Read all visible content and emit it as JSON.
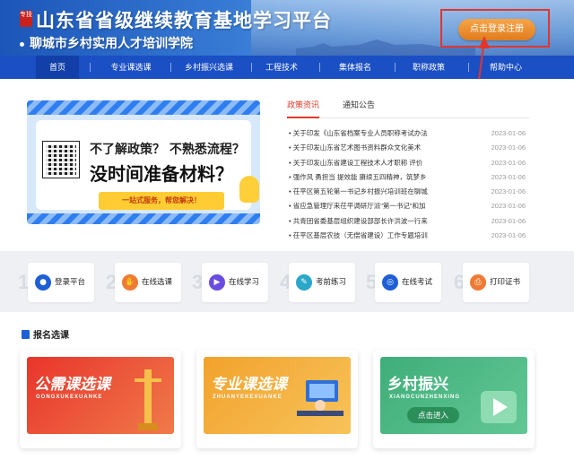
{
  "header": {
    "seal_text": "专技",
    "title": "山东省省级继续教育基地学习平台",
    "subtitle": "聊城市乡村实用人才培训学院",
    "login_button": "点击登录注册"
  },
  "nav": {
    "items": [
      "首页",
      "专业课选课",
      "乡村振兴选课",
      "工程技术",
      "集体报名",
      "职称政策",
      "帮助中心"
    ]
  },
  "promo": {
    "line1": "不了解政策？ 不熟悉流程？",
    "line2": "没时间准备材料？",
    "button": "一站式服务，帮您解决！"
  },
  "news": {
    "tabs": [
      "政策资讯",
      "通知公告"
    ],
    "items": [
      {
        "title": "关于印发《山东省档案专业人员职称考试办法",
        "date": "2023-01-06"
      },
      {
        "title": "关于印发山东省艺术图书资料群众文化美术",
        "date": "2023-01-06"
      },
      {
        "title": "关于印发山东省建设工程技术人才职称 评价",
        "date": "2023-01-06"
      },
      {
        "title": "强作风 勇担当 提效能 赓续五四精神，筑梦乡",
        "date": "2023-01-06"
      },
      {
        "title": "茌平区第五轮第一书记乡村振兴培训班在聊城",
        "date": "2023-01-06"
      },
      {
        "title": "省应急管理厅来茌平调研厅派\"第一书记\"和加",
        "date": "2023-01-06"
      },
      {
        "title": "共青团省委基层组织建设部部长许洪波一行来",
        "date": "2023-01-06"
      },
      {
        "title": "茌平区基层农技（无偿省建设）工作专题培训",
        "date": "2023-01-06"
      }
    ]
  },
  "steps": [
    {
      "num": "1",
      "label": "登录平台",
      "icon": "user-icon",
      "color": "#1f5fd6"
    },
    {
      "num": "2",
      "label": "在线选课",
      "icon": "hand-icon",
      "color": "#f07a34"
    },
    {
      "num": "3",
      "label": "在线学习",
      "icon": "video-icon",
      "color": "#6a4de0"
    },
    {
      "num": "4",
      "label": "考前练习",
      "icon": "pencil-icon",
      "color": "#2aa7c9"
    },
    {
      "num": "5",
      "label": "在线考试",
      "icon": "exam-icon",
      "color": "#1f5fd6"
    },
    {
      "num": "6",
      "label": "打印证书",
      "icon": "print-icon",
      "color": "#f07a34"
    }
  ],
  "courses": {
    "section_title": "报名选课",
    "cards": [
      {
        "title": "公需课选课",
        "sub": "GONGXUKEXUANKE",
        "color": "#e8352b"
      },
      {
        "title": "专业课选课",
        "sub": "ZHUANYEKEXUANKE",
        "color": "#f2a22c"
      },
      {
        "title": "乡村振兴",
        "sub": "XIANGCUNZHENXING",
        "color": "#3fae78",
        "enter": "点击进入"
      }
    ]
  }
}
